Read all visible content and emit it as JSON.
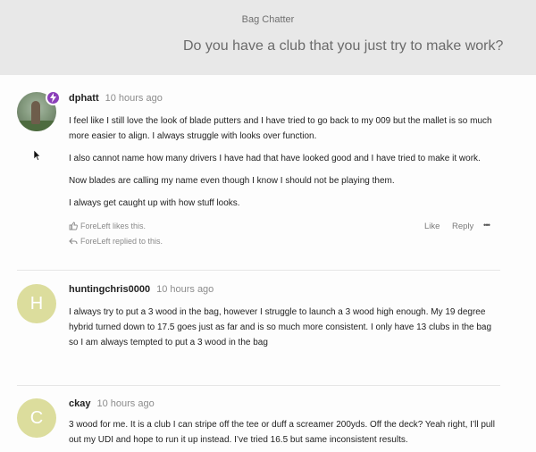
{
  "header": {
    "category": "Bag Chatter",
    "title": "Do you have a club that you just try to make work?"
  },
  "posts": [
    {
      "username": "dphatt",
      "time": "10 hours ago",
      "paragraphs": [
        "I feel like I still love the look of blade putters and I have tried to go back to my 009 but the mallet is so much more easier to align. I always struggle with looks over function.",
        "I also cannot name how many drivers I have had that have looked good and I have tried to make it work.",
        "Now blades are calling my name even though I know I should not be playing them.",
        "I always get caught up with how stuff looks."
      ],
      "likes_text": "ForeLeft likes this.",
      "reply_note": "ForeLeft replied to this.",
      "like_label": "Like",
      "reply_label": "Reply",
      "more_label": "•••"
    },
    {
      "username": "huntingchris0000",
      "time": "10 hours ago",
      "avatar_letter": "H",
      "paragraphs": [
        "I always try to put a 3 wood in the bag, however I struggle to launch a 3 wood high enough. My 19 degree hybrid turned down to 17.5 goes just as far and is so much more consistent. I only have 13 clubs in the bag so I am always tempted to put a 3 wood in the bag"
      ]
    },
    {
      "username": "ckay",
      "time": "10 hours ago",
      "avatar_letter": "C",
      "paragraphs": [
        "3 wood for me. It is a club I can stripe off the tee or duff a screamer 200yds. Off the deck? Yeah right, I’ll pull out my UDI and hope to run it up instead. I’ve tried 16.5 but same inconsistent results."
      ]
    }
  ],
  "colors": {
    "header_bg": "#e8e8e8",
    "badge": "#8b3fb9",
    "letter_avatar": "#dcdd9d"
  },
  "icons": {
    "badge": "lightning-icon",
    "like": "thumbs-up-icon",
    "reply": "reply-arrow-icon",
    "more": "ellipsis-icon"
  }
}
